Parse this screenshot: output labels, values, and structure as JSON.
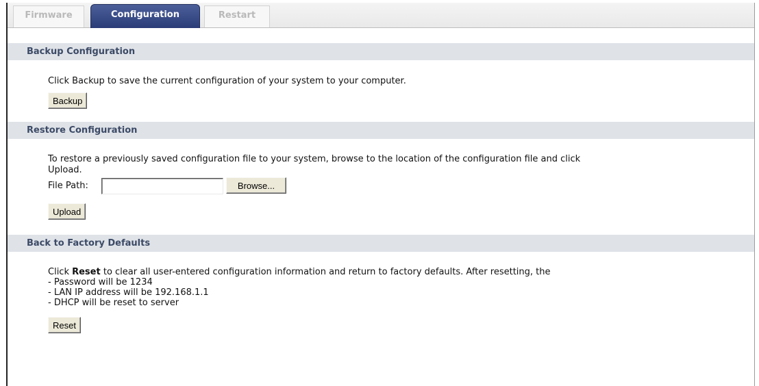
{
  "tabs": [
    "Firmware",
    "Configuration",
    "Restart"
  ],
  "backup": {
    "title": "Backup Configuration",
    "description": "Click Backup to save the current configuration of your system to your computer.",
    "button": "Backup"
  },
  "restore": {
    "title": "Restore Configuration",
    "description_line1": "To restore a previously saved configuration file to your system, browse to the location of the configuration file and click",
    "description_line2": "Upload.",
    "file_path_label": "File Path:",
    "file_path_value": "",
    "browse_button": "Browse...",
    "upload_button": "Upload"
  },
  "factory": {
    "title": "Back to Factory Defaults",
    "intro_prefix": "Click ",
    "intro_bold": "Reset",
    "intro_suffix": " to clear all user-entered configuration information and return to factory defaults. After resetting, the",
    "items": [
      "- Password will be 1234",
      "- LAN IP address will be 192.168.1.1",
      "- DHCP will be reset to server"
    ],
    "button": "Reset"
  }
}
